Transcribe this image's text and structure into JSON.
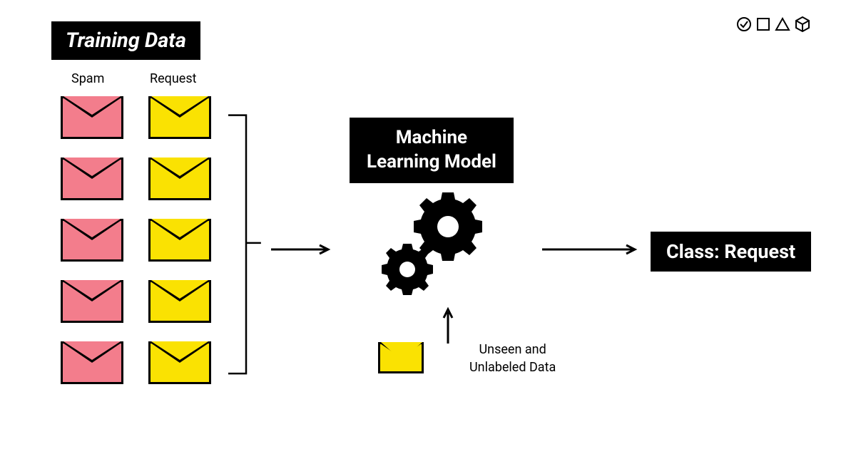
{
  "training": {
    "header": "Training Data",
    "columns": {
      "spam": {
        "label": "Spam",
        "count": 5
      },
      "request": {
        "label": "Request",
        "count": 5
      }
    }
  },
  "model": {
    "header_line1": "Machine",
    "header_line2": "Learning Model"
  },
  "unseen": {
    "label_line1": "Unseen and",
    "label_line2": "Unlabeled Data"
  },
  "output": {
    "label": "Class: Request"
  }
}
